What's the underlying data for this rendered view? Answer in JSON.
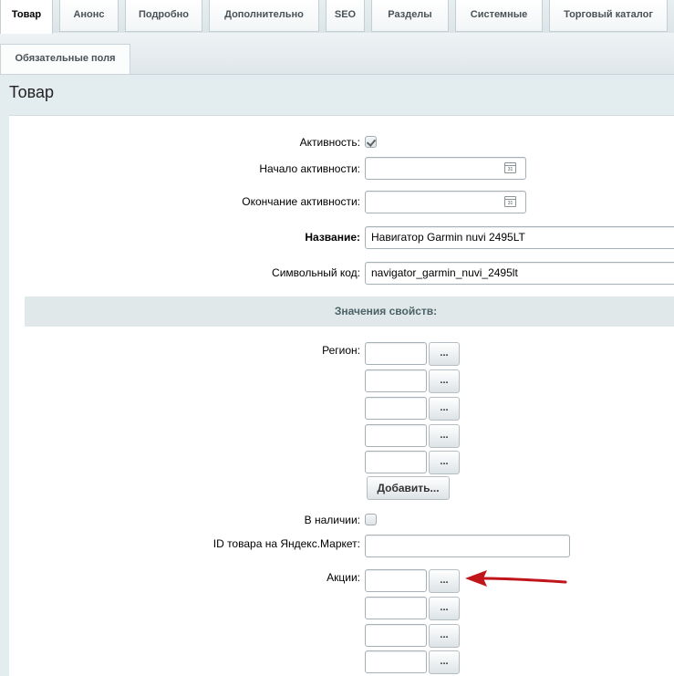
{
  "tabs": [
    "Товар",
    "Анонс",
    "Подробно",
    "Дополнительно",
    "SEO",
    "Разделы",
    "Системные",
    "Торговый каталог"
  ],
  "subtab": "Обязательные поля",
  "page_title": "Товар",
  "form": {
    "active_label": "Активность:",
    "active_start_label": "Начало активности:",
    "active_end_label": "Окончание активности:",
    "name_label": "Название:",
    "name_value": "Навигатор Garmin nuvi 2495LT",
    "code_label": "Символьный код:",
    "code_value": "navigator_garmin_nuvi_2495lt"
  },
  "properties": {
    "section_title": "Значения свойств:",
    "region_label": "Регион:",
    "dots_label": "...",
    "add_label": "Добавить...",
    "in_stock_label": "В наличии:",
    "yandex_label": "ID товара на Яндекс.Маркет:",
    "actions_label": "Акции:"
  },
  "colors": {
    "arrow": "#c0161b"
  },
  "icons": {
    "calendar": "calendar-icon",
    "arrow": "red-arrow-icon"
  }
}
